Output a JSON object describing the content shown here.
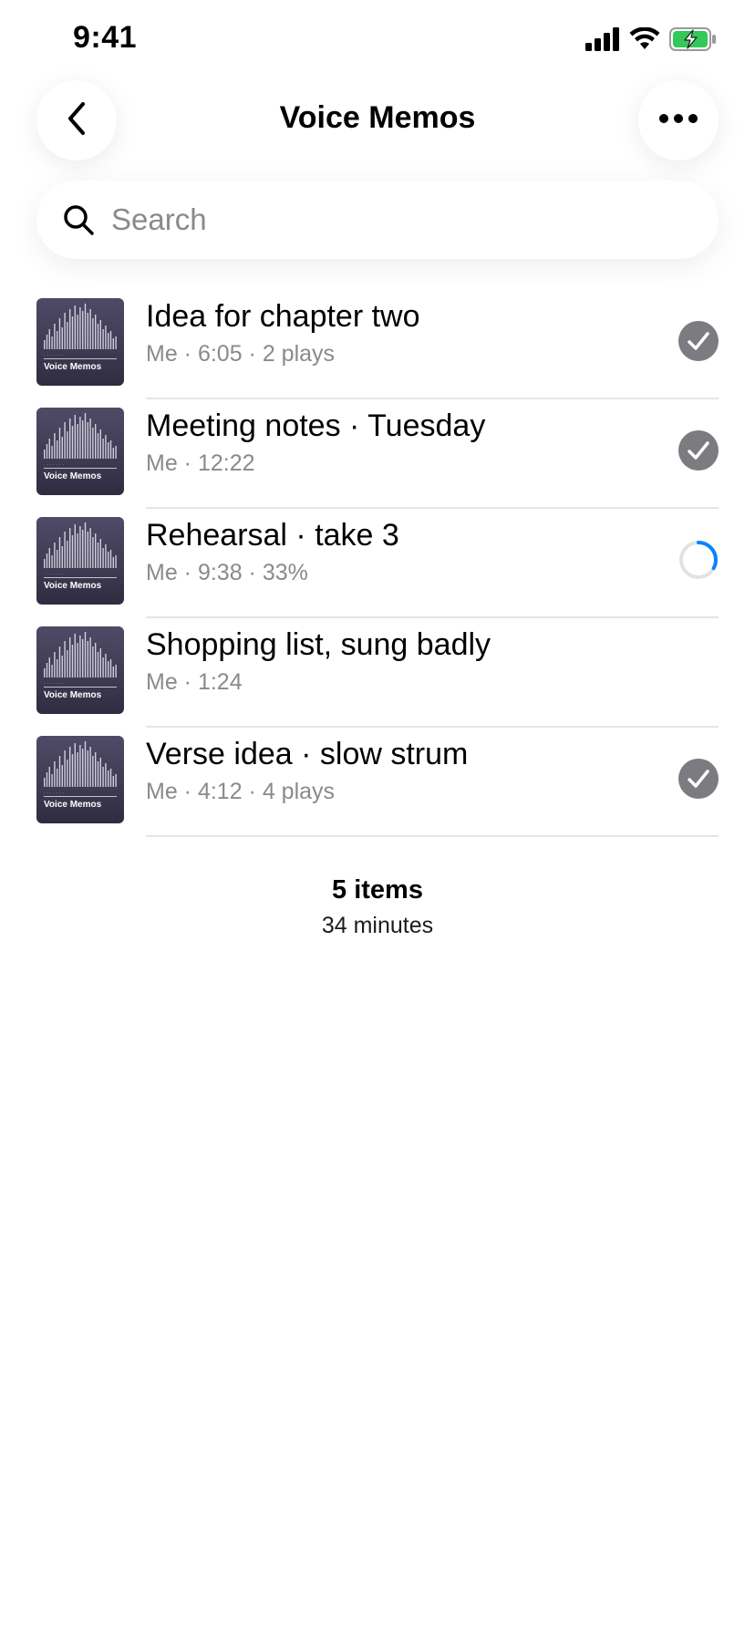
{
  "status_bar": {
    "time": "9:41",
    "icons": [
      "signal-icon",
      "wifi-icon",
      "battery-charging-icon"
    ],
    "battery_color": "#34c759"
  },
  "header": {
    "title": "Voice Memos",
    "back_icon": "chevron-left-icon",
    "more_icon": "ellipsis-icon"
  },
  "search": {
    "placeholder": "Search",
    "value": ""
  },
  "memos": [
    {
      "title": "Idea for chapter two",
      "meta": "Me · 6:05 · 2 plays",
      "status": "downloaded",
      "thumb_label": "Voice Memos"
    },
    {
      "title": "Meeting notes · Tuesday",
      "meta": "Me · 12:22",
      "status": "downloaded",
      "thumb_label": "Voice Memos"
    },
    {
      "title": "Rehearsal · take 3",
      "meta": "Me · 9:38 · 33%",
      "status": "downloading",
      "progress": 0.33,
      "thumb_label": "Voice Memos"
    },
    {
      "title": "Shopping list, sung badly",
      "meta": "Me · 1:24",
      "status": "none",
      "thumb_label": "Voice Memos"
    },
    {
      "title": "Verse idea · slow strum",
      "meta": "Me · 4:12 · 4 plays",
      "status": "downloaded",
      "thumb_label": "Voice Memos"
    }
  ],
  "summary": {
    "count": "5 items",
    "duration": "34 minutes"
  },
  "colors": {
    "accent": "#0a84ff",
    "check_badge": "#7c7c80",
    "secondary_text": "#8a8a8e",
    "divider": "#e5e5e7"
  }
}
